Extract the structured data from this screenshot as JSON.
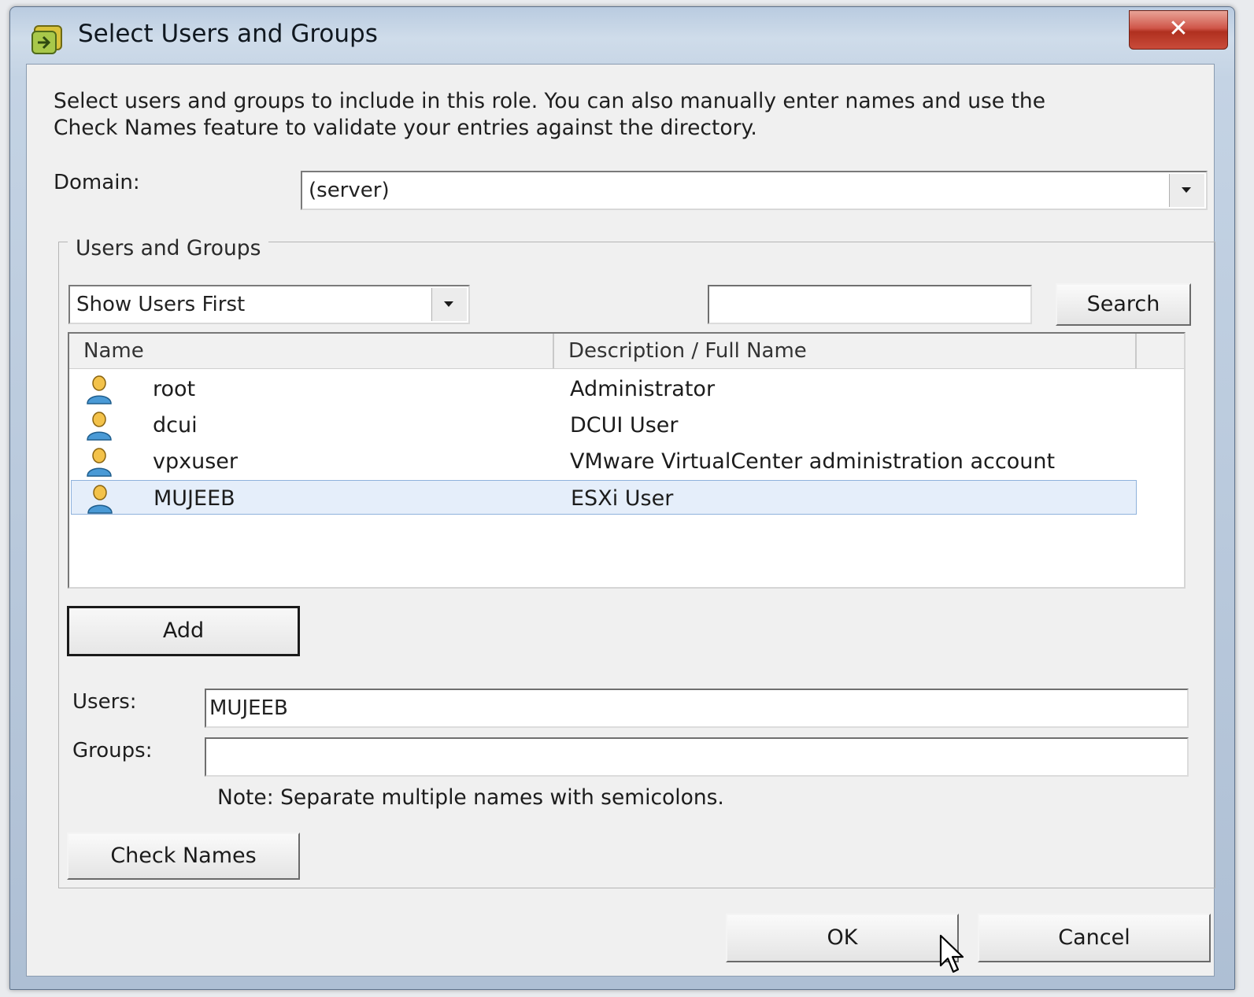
{
  "window": {
    "title": "Select Users and Groups",
    "close_label": "✕"
  },
  "intro": {
    "line1": "Select users and groups to include in this role. You can also manually enter names and use the",
    "line2": "Check Names feature to validate your entries against the directory."
  },
  "domain": {
    "label": "Domain:",
    "selected": "(server)"
  },
  "users_and_groups": {
    "legend": "Users and Groups",
    "sort_selected": "Show Users First",
    "search_value": "",
    "search_button": "Search",
    "columns": [
      "Name",
      "Description / Full Name"
    ],
    "rows": [
      {
        "name": "root",
        "description": "Administrator",
        "icon": "user-icon"
      },
      {
        "name": "dcui",
        "description": "DCUI User",
        "icon": "user-icon"
      },
      {
        "name": "vpxuser",
        "description": "VMware VirtualCenter administration account",
        "icon": "user-icon"
      },
      {
        "name": "MUJEEB",
        "description": "ESXi User",
        "icon": "user-icon",
        "selected": true
      }
    ],
    "add_button": "Add",
    "users_label": "Users:",
    "users_value": "MUJEEB",
    "groups_label": "Groups:",
    "groups_value": "",
    "note": "Note: Separate multiple names with semicolons.",
    "check_names_button": "Check Names"
  },
  "footer": {
    "ok_button": "OK",
    "cancel_button": "Cancel"
  },
  "colors": {
    "selection_background": "#e5eefa",
    "selection_border": "#8fb2dc",
    "close_button": "#c94b3a"
  }
}
